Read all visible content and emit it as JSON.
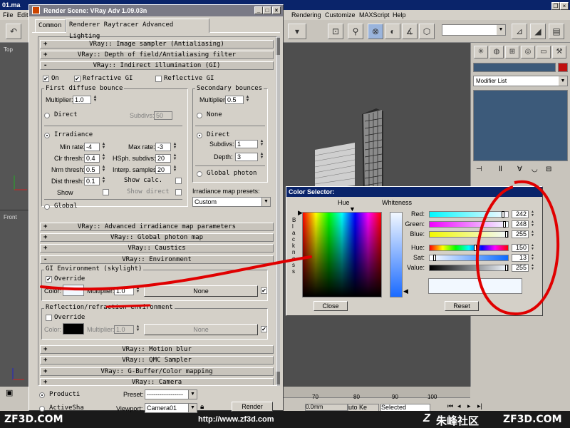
{
  "max": {
    "window_title": "01.ma",
    "menus": [
      "File",
      "Edit",
      "Rendering",
      "Customize",
      "MAXScript",
      "Help"
    ],
    "viewports": {
      "top": "Top",
      "front": "Front"
    },
    "modifier_list": "Modifier List",
    "timeline_ticks": [
      "70",
      "80",
      "90",
      "100"
    ],
    "auto_key": "uto Ke",
    "selected": "Selected",
    "status_z": "0.0mm"
  },
  "render": {
    "title": "Render Scene: VRay Adv 1.09.03n",
    "tabs": [
      "Common",
      "Renderer",
      "Raytracer",
      "Advanced Lighting"
    ],
    "rollouts": {
      "image_sampler": "VRay:: Image sampler (Antialiasing)",
      "dof": "VRay:: Depth of field/Antialiasing filter",
      "gi": "VRay:: Indirect illumination (GI)",
      "adv_irr": "VRay:: Advanced irradiance map parameters",
      "photon_map": "VRay:: Global photon map",
      "caustics": "VRay:: Caustics",
      "environment": "VRay:: Environment",
      "motion_blur": "VRay:: Motion blur",
      "qmc": "VRay:: QMC Sampler",
      "gbuffer": "VRay:: G-Buffer/Color mapping",
      "camera": "VRay:: Camera"
    },
    "gi": {
      "on": "On",
      "refractive": "Refractive GI",
      "reflective": "Reflective GI",
      "first_bounce": "First diffuse bounce",
      "multiplier_label": "Multiplier:",
      "first_mult": "1.0",
      "direct": "Direct",
      "subdivs_label": "Subdivs:",
      "direct_subdivs": "50",
      "irradiance": "Irradiance",
      "min_rate_label": "Min rate:",
      "min_rate": "-4",
      "max_rate_label": "Max rate:",
      "max_rate": "-3",
      "clr_thresh_label": "Clr thresh:",
      "clr_thresh": "0.4",
      "hsph_label": "HSph. subdivs:",
      "hsph": "20",
      "nrm_thresh_label": "Nrm thresh:",
      "nrm_thresh": "0.5",
      "interp_label": "Interp. samples:",
      "interp": "20",
      "dist_thresh_label": "Dist thresh:",
      "dist_thresh": "0.1",
      "show_calc": "Show calc.",
      "show": "Show",
      "show_direct": "Show direct",
      "global": "Global",
      "secondary": "Secondary bounces",
      "sec_mult": "0.5",
      "none": "None",
      "sec_direct": "Direct",
      "sec_subdivs_label": "Subdivs:",
      "sec_subdivs": "1",
      "depth_label": "Depth:",
      "depth": "3",
      "global_photon": "Global photon",
      "presets_label": "Irradiance map presets:",
      "preset": "Custom"
    },
    "env": {
      "gi_env": "GI Environment (skylight)",
      "override": "Override",
      "color_label": "Color:",
      "multiplier_label": "Multiplier:",
      "gi_mult": "1.0",
      "none": "None",
      "refl_env": "Reflection/refraction environment",
      "refl_override": "Override",
      "refl_mult": "1.0",
      "refl_none": "None"
    },
    "bottom": {
      "production": "Producti",
      "activeshade": "ActiveSha",
      "preset_label": "Preset:",
      "preset": "-----------------",
      "viewport_label": "Viewport:",
      "viewport": "Camera01",
      "render": "Render"
    }
  },
  "color_selector": {
    "title": "Color Selector:",
    "hue_label": "Hue",
    "whiteness_label": "Whiteness",
    "blackness_label": "Blackness",
    "channels": [
      {
        "label": "Red:",
        "value": "242",
        "fraction": 0.949
      },
      {
        "label": "Green:",
        "value": "248",
        "fraction": 0.973
      },
      {
        "label": "Blue:",
        "value": "255",
        "fraction": 1.0
      },
      {
        "label": "Hue:",
        "value": "150",
        "fraction": 0.588
      },
      {
        "label": "Sat:",
        "value": "13",
        "fraction": 0.051
      },
      {
        "label": "Value:",
        "value": "255",
        "fraction": 1.0
      }
    ],
    "close": "Close",
    "reset": "Reset",
    "swatch_color": "#f2f8ff"
  },
  "footer": {
    "left": "ZF3D.COM",
    "url": "http://www.zf3d.com",
    "cn": "朱峰社区",
    "right": "ZF3D.COM"
  },
  "colors": {
    "annotation": "#e00000",
    "title_active": "#0a246a",
    "title_inactive": "#7a7a86"
  }
}
